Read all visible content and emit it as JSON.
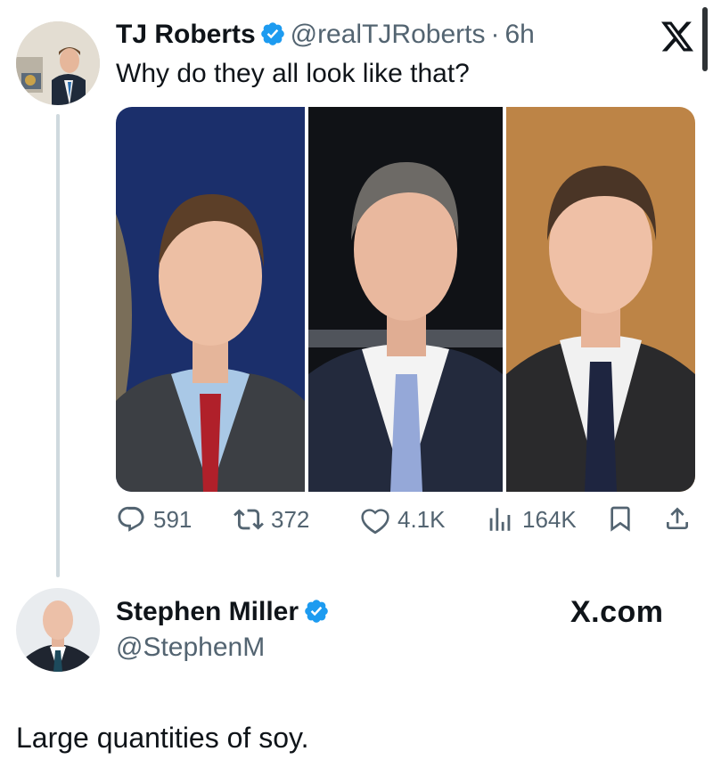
{
  "original_tweet": {
    "author_name": "TJ Roberts",
    "author_handle": "@realTJRoberts",
    "separator": "·",
    "time": "6h",
    "verified": true,
    "text": "Why do they all look like that?",
    "media_count": 3,
    "actions": {
      "replies": "591",
      "retweets": "372",
      "likes": "4.1K",
      "views": "164K"
    }
  },
  "reply": {
    "author_name": "Stephen Miller",
    "author_handle": "@StephenM",
    "verified": true,
    "text": "Large quantities of soy."
  },
  "branding": {
    "logo_text": "X.com"
  },
  "colors": {
    "verified_blue": "#1d9bf0",
    "text": "#0f1419",
    "secondary": "#536471",
    "thread_line": "#cfd9de"
  },
  "icons": [
    "x-logo-icon",
    "verified-badge-icon",
    "reply-icon",
    "retweet-icon",
    "like-icon",
    "views-icon",
    "bookmark-icon",
    "share-icon"
  ]
}
